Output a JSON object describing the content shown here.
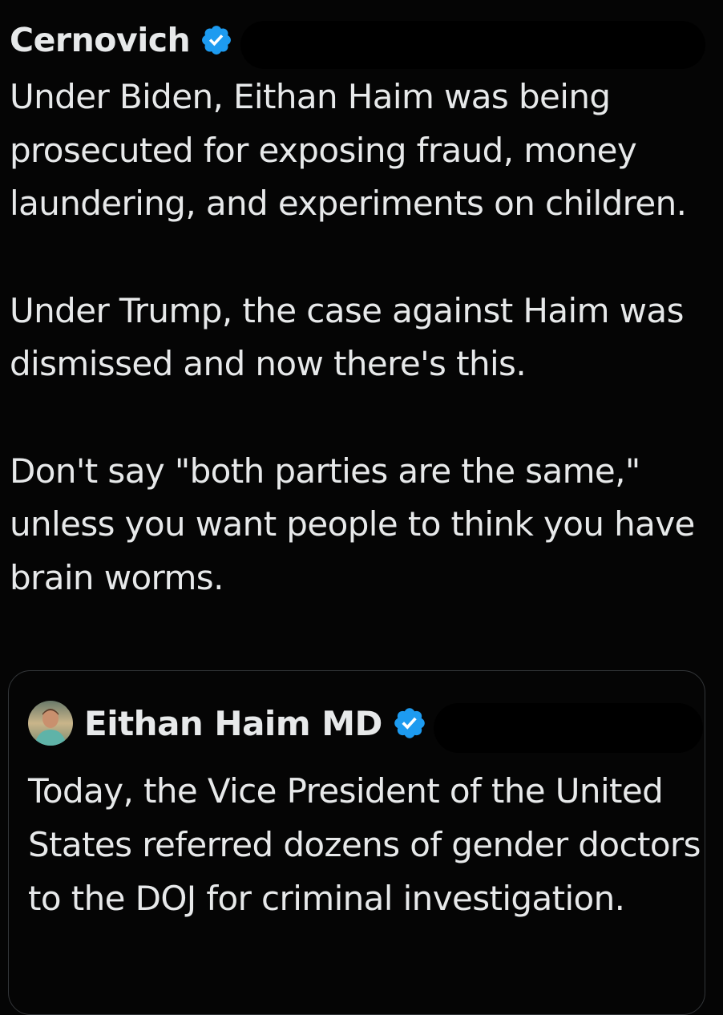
{
  "tweet": {
    "author": {
      "display_name": "Cernovich",
      "verified": true,
      "badge_icon": "verified-badge-icon"
    },
    "paragraphs": [
      "Under Biden, Eithan Haim was being prosecuted for exposing fraud, money laundering, and experiments on children.",
      "Under Trump, the case against Haim was dismissed and now there's this.",
      "Don't say \"both parties are the same,\" unless you want people to think you have brain worms."
    ]
  },
  "quoted_tweet": {
    "author": {
      "display_name": "Eithan Haim MD",
      "verified": true,
      "avatar_icon": "profile-photo-avatar",
      "badge_icon": "verified-badge-icon"
    },
    "text": "Today, the Vice President of the United States referred dozens of gender doctors to the DOJ for criminal investigation."
  },
  "colors": {
    "background": "#050505",
    "text": "#e7e9ea",
    "verified_blue": "#1d9bf0",
    "quote_border": "#333639"
  }
}
